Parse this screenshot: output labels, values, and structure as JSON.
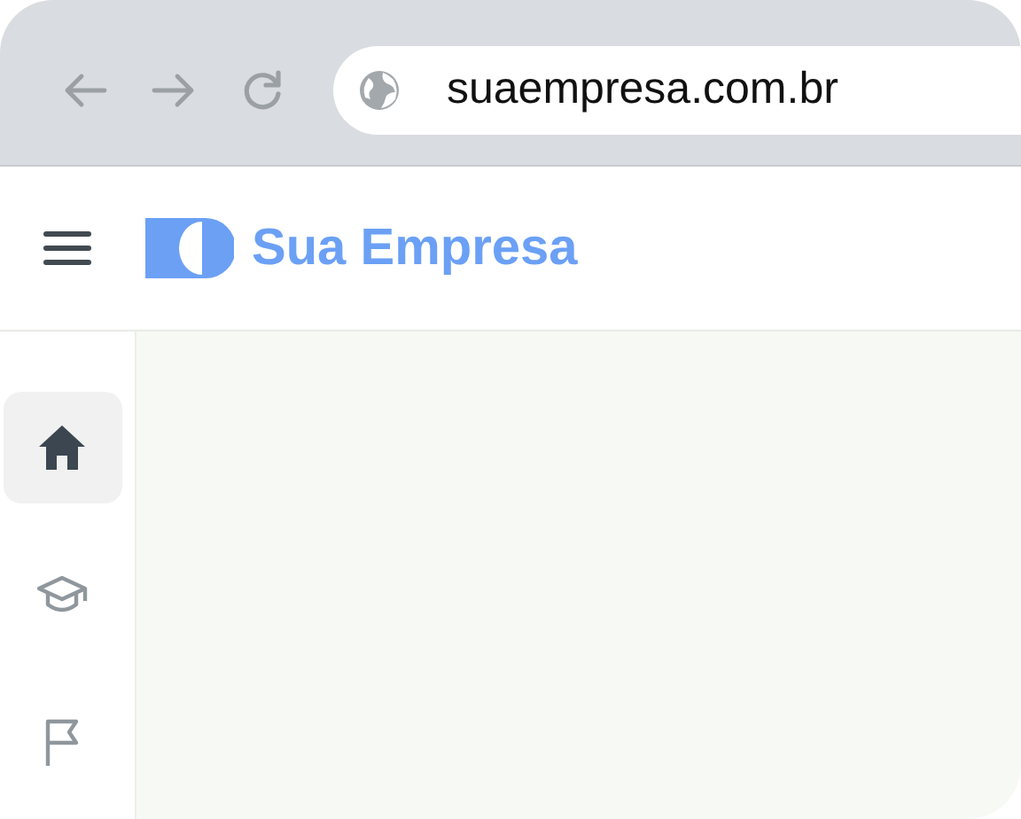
{
  "browser": {
    "address": "suaempresa.com.br"
  },
  "header": {
    "brand": "Sua Empresa"
  },
  "sidebar": {
    "items": [
      {
        "kind": "home",
        "selected": true
      },
      {
        "kind": "course",
        "selected": false
      },
      {
        "kind": "flag",
        "selected": false
      }
    ]
  }
}
